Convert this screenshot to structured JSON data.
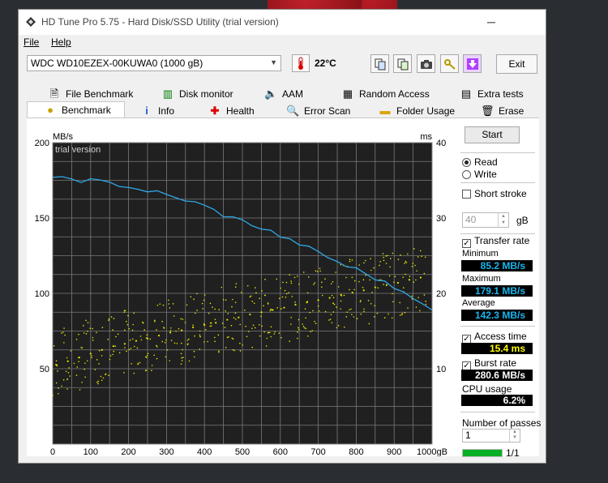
{
  "window": {
    "title": "HD Tune Pro 5.75 - Hard Disk/SSD Utility (trial version)"
  },
  "menu": {
    "file": "File",
    "help": "Help"
  },
  "toolbar": {
    "drive": "WDC WD10EZEX-00KUWA0 (1000 gB)",
    "temperature": "22°C",
    "exit_label": "Exit"
  },
  "tabs": {
    "top": [
      {
        "label": "File Benchmark",
        "icon": "file-benchmark-icon"
      },
      {
        "label": "Disk monitor",
        "icon": "disk-monitor-icon"
      },
      {
        "label": "AAM",
        "icon": "speaker-icon"
      },
      {
        "label": "Random Access",
        "icon": "random-access-icon"
      },
      {
        "label": "Extra tests",
        "icon": "extra-tests-icon"
      }
    ],
    "bottom": [
      {
        "label": "Benchmark",
        "icon": "benchmark-icon"
      },
      {
        "label": "Info",
        "icon": "info-icon"
      },
      {
        "label": "Health",
        "icon": "health-icon"
      },
      {
        "label": "Error Scan",
        "icon": "magnifier-icon"
      },
      {
        "label": "Folder Usage",
        "icon": "folder-icon"
      },
      {
        "label": "Erase",
        "icon": "trash-icon"
      }
    ]
  },
  "side": {
    "start_label": "Start",
    "read_label": "Read",
    "write_label": "Write",
    "short_stroke_label": "Short stroke",
    "short_stroke_value": "40",
    "short_stroke_unit": "gB",
    "transfer_rate_label": "Transfer rate",
    "minimum_label": "Minimum",
    "minimum_value": "85.2 MB/s",
    "maximum_label": "Maximum",
    "maximum_value": "179.1 MB/s",
    "average_label": "Average",
    "average_value": "142.3 MB/s",
    "access_time_label": "Access time",
    "access_time_value": "15.4 ms",
    "burst_rate_label": "Burst rate",
    "burst_rate_value": "280.6 MB/s",
    "cpu_usage_label": "CPU usage",
    "cpu_usage_value": "6.2%",
    "passes_label": "Number of passes",
    "passes_value": "1",
    "progress_text": "1/1",
    "progress_fraction": 1.0
  },
  "colors": {
    "transfer_line": "#2fa8e6",
    "access_dots": "#e8e600",
    "stat_cyan": "#19b8f0",
    "stat_yellow": "#ffff00",
    "stat_white": "#ffffff"
  },
  "chart_data": {
    "type": "line",
    "watermark": "trial version",
    "ylabel_left": "MB/s",
    "ylabel_right": "ms",
    "xlim": [
      0,
      1000
    ],
    "ylim_left": [
      0,
      200
    ],
    "ylim_right": [
      0,
      40
    ],
    "x_ticks": [
      "0",
      "100",
      "200",
      "300",
      "400",
      "500",
      "600",
      "700",
      "800",
      "900",
      "1000gB"
    ],
    "y_ticks_left": [
      "200",
      "150",
      "100",
      "50"
    ],
    "y_ticks_right": [
      "40",
      "30",
      "20",
      "10"
    ],
    "grid": true,
    "series": [
      {
        "type": "line",
        "x": [
          0,
          25,
          50,
          75,
          100,
          125,
          150,
          175,
          200,
          225,
          250,
          275,
          300,
          325,
          350,
          375,
          400,
          425,
          450,
          475,
          500,
          525,
          550,
          575,
          600,
          625,
          650,
          675,
          700,
          725,
          750,
          775,
          800,
          825,
          850,
          875,
          900,
          925,
          950,
          975,
          1000
        ],
        "y": [
          177,
          176,
          176,
          175,
          175,
          174,
          173,
          172,
          171,
          169,
          168,
          167,
          165,
          163,
          162,
          160,
          158,
          155,
          152,
          150,
          148,
          146,
          143,
          141,
          138,
          135,
          133,
          130,
          127,
          124,
          121,
          118,
          116,
          113,
          110,
          107,
          104,
          101,
          98,
          94,
          89
        ]
      },
      {
        "type": "scatter",
        "note_axis": "right",
        "x": [
          10,
          40,
          70,
          100,
          130,
          160,
          190,
          220,
          250,
          280,
          310,
          340,
          370,
          400,
          430,
          460,
          490,
          520,
          550,
          580,
          610,
          640,
          670,
          700,
          730,
          760,
          790,
          820,
          850,
          880,
          910,
          940,
          970
        ],
        "y": [
          10.5,
          11.0,
          11.5,
          12.0,
          12.5,
          13.0,
          13.3,
          13.7,
          14.0,
          14.4,
          14.8,
          15.1,
          15.5,
          15.8,
          16.1,
          16.5,
          16.8,
          17.2,
          17.5,
          17.8,
          18.1,
          18.5,
          18.8,
          19.1,
          19.4,
          19.8,
          20.1,
          20.4,
          20.8,
          21.1,
          21.4,
          21.8,
          22.1
        ]
      }
    ]
  }
}
